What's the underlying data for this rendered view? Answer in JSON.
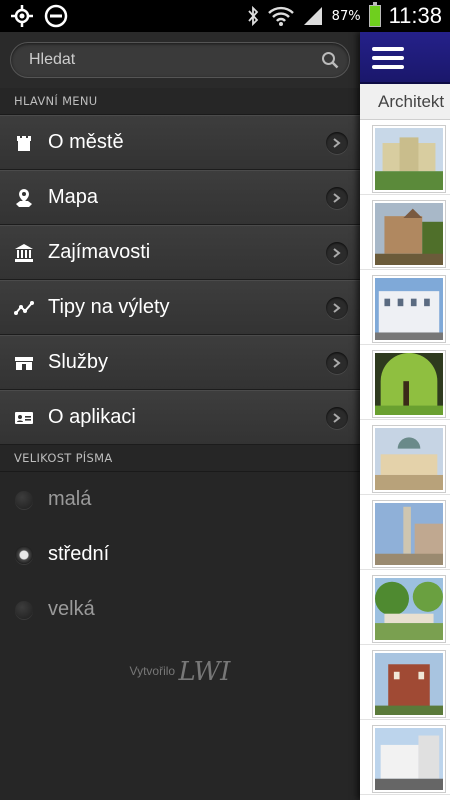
{
  "status_bar": {
    "icons_left": [
      "gps-icon",
      "block-icon"
    ],
    "icons_right": [
      "bluetooth-icon",
      "wifi-icon",
      "signal-icon",
      "battery-icon"
    ],
    "battery_percent": "87%",
    "time": "11:38"
  },
  "drawer": {
    "search": {
      "placeholder": "Hledat"
    },
    "main_menu_header": "HLAVNÍ MENU",
    "items": [
      {
        "label": "O městě",
        "icon": "tower-icon"
      },
      {
        "label": "Mapa",
        "icon": "map-pin-icon"
      },
      {
        "label": "Zajímavosti",
        "icon": "museum-icon"
      },
      {
        "label": "Tipy na výlety",
        "icon": "route-icon"
      },
      {
        "label": "Služby",
        "icon": "shop-icon"
      },
      {
        "label": "O aplikaci",
        "icon": "id-card-icon"
      }
    ],
    "font_size_header": "VELIKOST PÍSMA",
    "font_sizes": [
      {
        "label": "malá",
        "selected": false
      },
      {
        "label": "střední",
        "selected": true
      },
      {
        "label": "velká",
        "selected": false
      }
    ],
    "credit_text": "Vytvořilo",
    "credit_logo": "LWI"
  },
  "content": {
    "tab_label": "Architekt",
    "thumbnails": 9
  },
  "colors": {
    "topbar": "#25218a",
    "drawer_bg": "#262626",
    "battery": "#6fcf1e"
  }
}
